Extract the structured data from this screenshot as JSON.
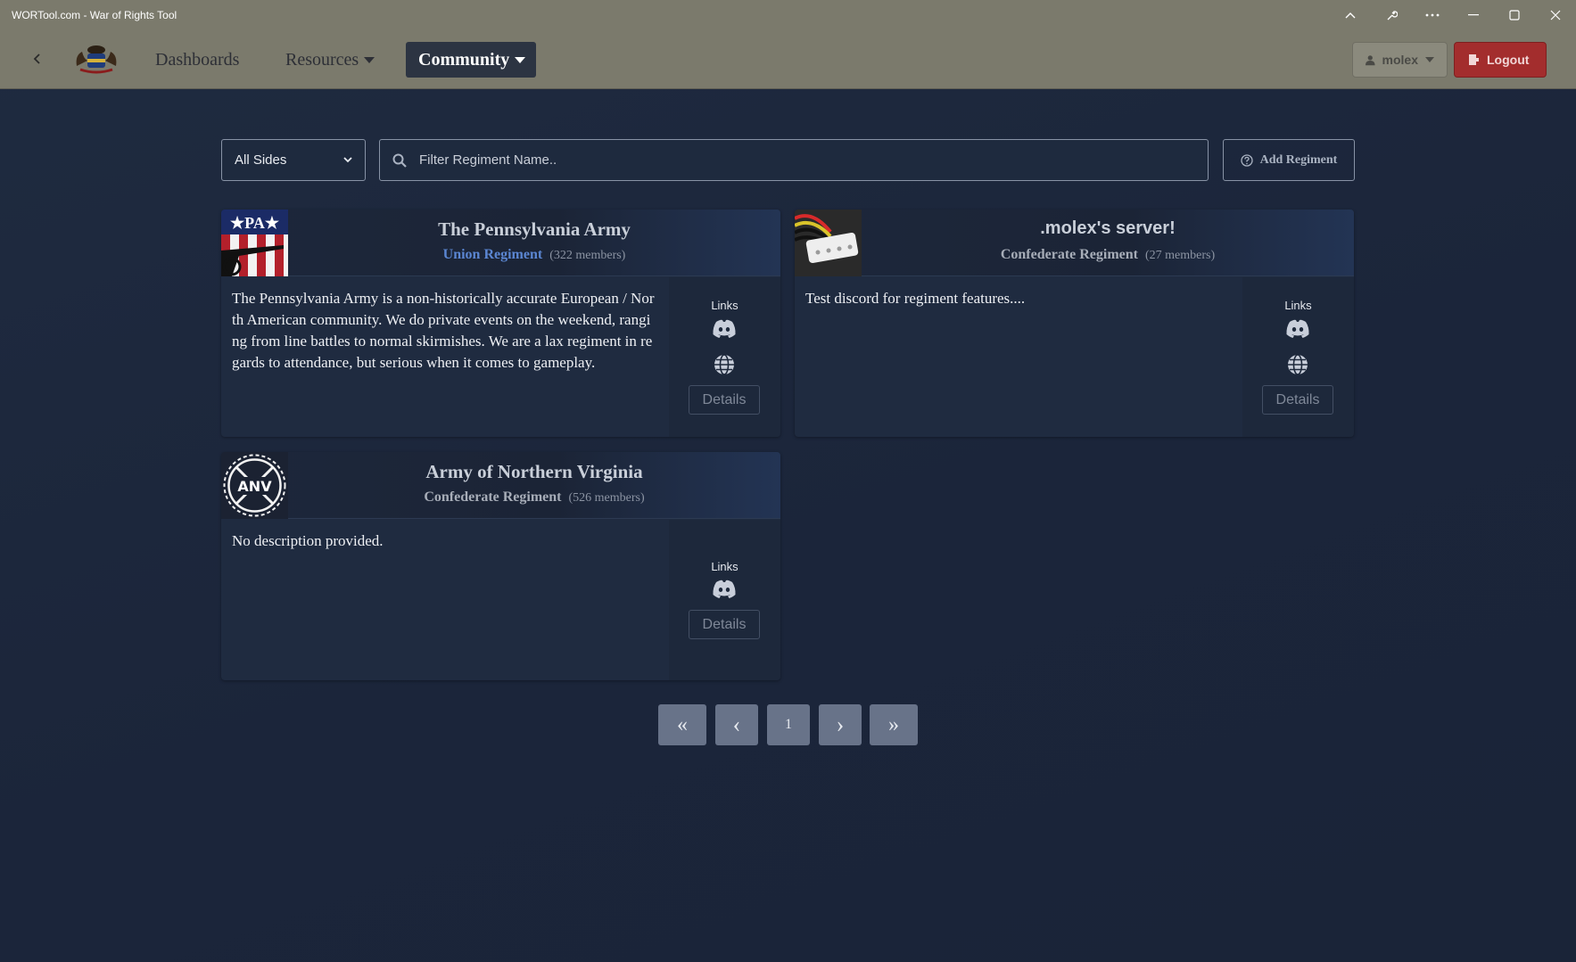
{
  "window": {
    "title": "WORTool.com - War of Rights Tool"
  },
  "nav": {
    "dashboards": "Dashboards",
    "resources": "Resources",
    "community": "Community",
    "user": "molex",
    "logout": "Logout"
  },
  "filters": {
    "side_selected": "All Sides",
    "search_placeholder": "Filter Regiment Name..",
    "search_value": "",
    "add_regiment": "Add Regiment"
  },
  "regiments": [
    {
      "name": "The Pennsylvania Army",
      "side": "Union Regiment",
      "members": "(322 members)",
      "description": "The Pennsylvania Army is a non-historically accurate European / North American community. We do private events on the weekend, ranging from line battles to normal skirmishes. We are a lax regiment in regards to attendance, but serious when it comes to gameplay.",
      "links_label": "Links",
      "links": [
        "discord-icon",
        "globe-icon"
      ],
      "details": "Details",
      "image_text": "★PA★"
    },
    {
      "name": ".molex's server!",
      "side": "Confederate Regiment",
      "members": "(27 members)",
      "description": "Test discord for regiment features....",
      "links_label": "Links",
      "links": [
        "discord-icon",
        "globe-icon"
      ],
      "details": "Details"
    },
    {
      "name": "Army of Northern Virginia",
      "side": "Confederate Regiment",
      "members": "(526 members)",
      "description": "No description provided.",
      "links_label": "Links",
      "links": [
        "discord-icon"
      ],
      "details": "Details",
      "image_text": "ANV"
    }
  ],
  "pagination": {
    "first": "«",
    "prev": "‹",
    "current": "1",
    "next": "›",
    "last": "»"
  },
  "colors": {
    "background": "#1c2639",
    "titlebar": "#7b7a6c",
    "union": "#5b86d2",
    "logout": "#a32d2d"
  }
}
